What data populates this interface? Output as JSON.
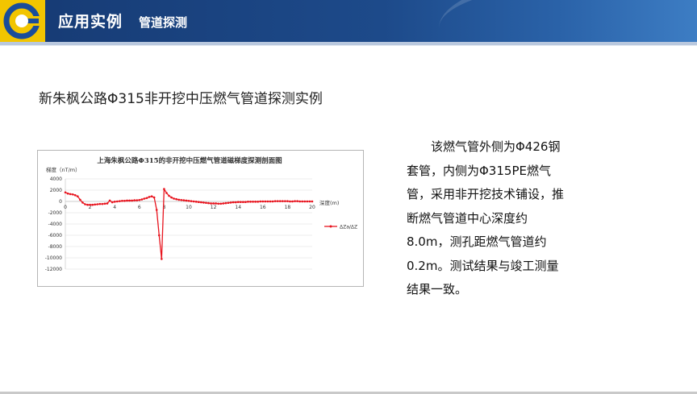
{
  "header": {
    "title": "应用实例",
    "subtitle": "管道探测"
  },
  "colors": {
    "header_bg": "#1d4a8a",
    "logo_yellow": "#f2c500",
    "logo_blue": "#1a4d9a",
    "series": "#e8141e"
  },
  "case_title": "新朱枫公路Φ315非开挖中压燃气管道探测实例",
  "description": "该燃气管外侧为Φ426钢套管，内侧为Φ315PE燃气管，采用非开挖技术铺设，推断燃气管道中心深度约8.0m，测孔距燃气管道约0.2m。测试结果与竣工测量结果一致。",
  "chart_data": {
    "type": "line",
    "title": "上海朱枫公路Φ315的非开挖中压燃气管道磁梯度探测剖面图",
    "ylabel": "梯度（nT/m）",
    "xlabel": "深度(m)",
    "xlim": [
      0,
      20
    ],
    "ylim": [
      -12000,
      4000
    ],
    "xticks": [
      "0",
      "2",
      "4",
      "6",
      "8",
      "10",
      "12",
      "14",
      "16",
      "18",
      "20"
    ],
    "yticks": [
      "4000",
      "2000",
      "0",
      "-2000",
      "-4000",
      "-6000",
      "-8000",
      "-10000",
      "-12000"
    ],
    "grid": true,
    "legend_position": "right",
    "series": [
      {
        "name": "ΔZa/ΔZ",
        "x": [
          0.0,
          0.2,
          0.4,
          0.6,
          0.8,
          1.0,
          1.2,
          1.4,
          1.6,
          1.8,
          2.0,
          2.2,
          2.4,
          2.6,
          2.8,
          3.0,
          3.2,
          3.4,
          3.6,
          3.8,
          4.0,
          4.2,
          4.4,
          4.6,
          4.8,
          5.0,
          5.2,
          5.4,
          5.6,
          5.8,
          6.0,
          6.2,
          6.4,
          6.6,
          6.8,
          7.0,
          7.2,
          7.4,
          7.6,
          7.8,
          8.0,
          8.2,
          8.4,
          8.6,
          8.8,
          9.0,
          9.2,
          9.4,
          9.6,
          9.8,
          10.0,
          10.2,
          10.4,
          10.6,
          10.8,
          11.0,
          11.2,
          11.4,
          11.6,
          11.8,
          12.0,
          12.2,
          12.4,
          12.6,
          12.8,
          13.0,
          13.2,
          13.4,
          13.6,
          13.8,
          14.0,
          14.2,
          14.4,
          14.6,
          14.8,
          15.0,
          15.2,
          15.4,
          15.6,
          15.8,
          16.0,
          16.2,
          16.4,
          16.6,
          16.8,
          17.0,
          17.2,
          17.4,
          17.6,
          17.8,
          18.0,
          18.2,
          18.4,
          18.6,
          18.8,
          19.0,
          19.2,
          19.4,
          19.6,
          19.8,
          20.0
        ],
        "values": [
          1600,
          1400,
          1300,
          1250,
          1100,
          900,
          300,
          -200,
          -500,
          -600,
          -600,
          -600,
          -550,
          -500,
          -450,
          -450,
          -400,
          -350,
          150,
          -150,
          -50,
          0,
          50,
          100,
          100,
          150,
          150,
          150,
          200,
          200,
          250,
          350,
          500,
          600,
          800,
          900,
          700,
          -1500,
          -6000,
          -10200,
          2200,
          1500,
          1000,
          700,
          500,
          400,
          300,
          250,
          200,
          150,
          100,
          50,
          0,
          -50,
          -100,
          -150,
          -200,
          -250,
          -300,
          -350,
          -350,
          -350,
          -400,
          -400,
          -350,
          -300,
          -250,
          -200,
          -150,
          -150,
          -100,
          -100,
          -100,
          -100,
          -50,
          -50,
          -50,
          -50,
          -50,
          0,
          0,
          0,
          0,
          0,
          0,
          50,
          50,
          50,
          50,
          50,
          50,
          0,
          0,
          50,
          50,
          0,
          0,
          0,
          0,
          0,
          0
        ]
      }
    ]
  }
}
